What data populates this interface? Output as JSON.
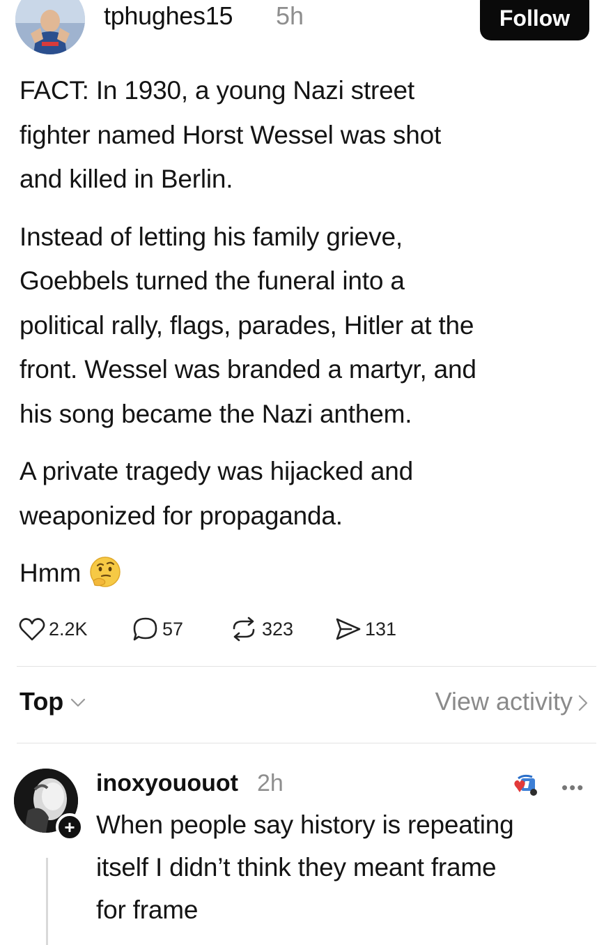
{
  "post": {
    "author": {
      "username": "tphughes15",
      "time": "5h",
      "avatar": "avatar-photo"
    },
    "follow_label": "Follow",
    "paragraphs": [
      [
        "FACT: In 1930, a young Nazi street",
        "fighter named Horst Wessel was shot",
        "and killed in Berlin."
      ],
      [
        "Instead of letting his family grieve,",
        "Goebbels turned the funeral into a",
        "political rally, flags, parades, Hitler at the",
        "front. Wessel was branded a martyr, and",
        "his song became the Nazi anthem."
      ],
      [
        "A private tragedy was hijacked and",
        "weaponized for propaganda."
      ]
    ],
    "closing_text": "Hmm",
    "closing_emoji": "thinking-face-icon",
    "stats": {
      "likes": "2.2K",
      "comments": "57",
      "reposts": "323",
      "shares": "131"
    }
  },
  "sort": {
    "label": "Top",
    "view_activity_label": "View activity"
  },
  "reply": {
    "username": "inoxyououot",
    "time": "2h",
    "lines": [
      "When people say history is repeating",
      "itself I didn’t think they meant frame",
      "for frame"
    ],
    "more_label": "•••",
    "plus_label": "+"
  }
}
